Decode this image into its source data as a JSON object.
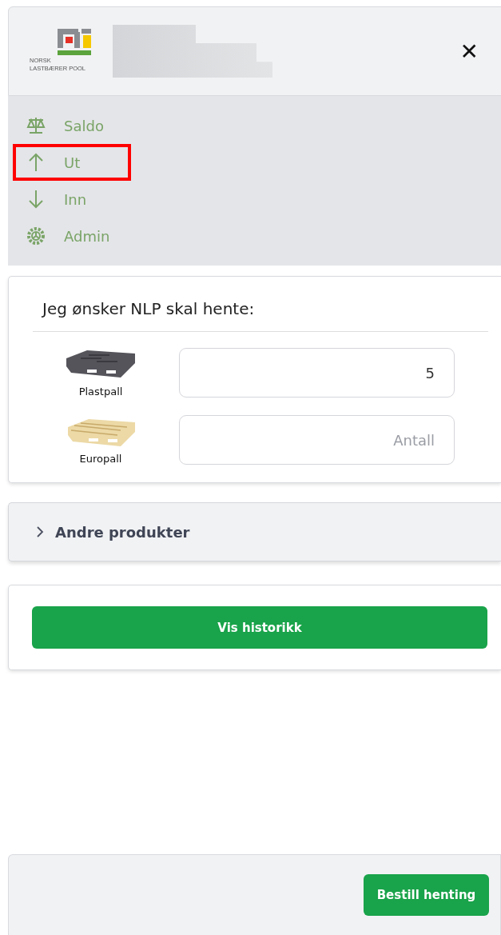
{
  "header": {
    "logo": {
      "line_1": "NORSK",
      "line_2": "LASTBÆRER POOL"
    },
    "close_label": "✕"
  },
  "nav": {
    "items": [
      {
        "label": "Saldo",
        "highlighted": false
      },
      {
        "label": "Ut",
        "highlighted": true
      },
      {
        "label": "Inn",
        "highlighted": false
      },
      {
        "label": "Admin",
        "highlighted": false
      }
    ]
  },
  "order_card": {
    "title": "Jeg ønsker NLP skal hente:",
    "products": [
      {
        "name": "Plastpall",
        "kind": "plastic",
        "value": "5"
      },
      {
        "name": "Europall",
        "kind": "wood",
        "placeholder": "Antall"
      }
    ]
  },
  "other_products": {
    "label": "Andre produkter",
    "expanded": false
  },
  "history_button": "Vis historikk",
  "footer": {
    "order_button": "Bestill henting"
  }
}
